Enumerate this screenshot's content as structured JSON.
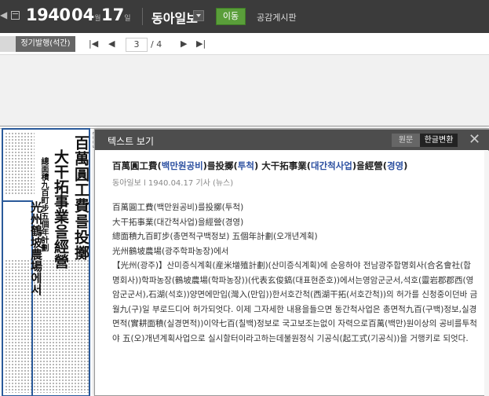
{
  "topbar": {
    "year": "1940",
    "month": "04",
    "month_unit": "월",
    "day": "17",
    "day_unit": "일",
    "paper": "동아일보",
    "go_button": "이동",
    "board_link": "공감게시판"
  },
  "subbar": {
    "tab_active": "정기발행(석간)",
    "current_page": "3",
    "total_pages": "/ 4"
  },
  "popup": {
    "title": "텍스트 보기",
    "btn_original": "원문",
    "btn_convert": "한글변환",
    "article_title_a": "百萬圓工費(",
    "article_title_b": "백만원공비",
    "article_title_c": ")를投擲(",
    "article_title_d": "투척",
    "article_title_e": ") 大干拓事業(",
    "article_title_f": "대간척사업",
    "article_title_g": ")을經營(",
    "article_title_h": "경영",
    "article_title_i": ")",
    "meta": "동아일보 l 1940.04.17 기사 (뉴스)",
    "body": "百萬圓工費(백만원공비)를投擲(투척)\n大干拓事業(대간척사업)을經營(경영)\n總面積九百町步(총면적구백정보) 五個年計劃(오개년계획)\n光州鶴坡農場(광주학파농장)에서\n【光州(광주)】산미증식계획(産米增殖計劃)(산미증식계획)에 순응하야 전남광주합명회사(合名會社(합명회사))학파농장(鶴坡農場(학파농장))(代表玄俊鎬(대표현준호))에서는영암군군서,석호(靈岩郡郡西(영암군군서),石湖(석호))양면에만입(灣入(만입))한서호간척(西湖干拓(서호간척))의 허가를 신청중이던바 금월九(구)일 부로드디어 허가되엇다. 이제 그자세한 내용을들으면 동간척사업은 총면적九百(구백)정보,실경면적(實耕面積(실경면적))이약七百(칠백)정보로 국고보조는없이 자력으로百萬(백만)원이상의 공비를투척야 五(오)개년계획사업으로 실시할터이라고하는데불원정식 기공식(起工式(기공식))을 거행키로 되엇다."
  }
}
